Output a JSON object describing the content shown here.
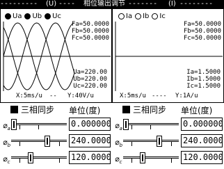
{
  "title": {
    "left_tag": "(U)",
    "center": "相位输出调节",
    "right_tag": "(I)"
  },
  "voltage_panel": {
    "channels": [
      {
        "label": "Ua",
        "selected": true
      },
      {
        "label": "Ub",
        "selected": true
      },
      {
        "label": "Uc",
        "selected": true
      }
    ],
    "freq": [
      "Fa=50.0000",
      "Fb=50.0000",
      "Fc=50.0000"
    ],
    "amps": [
      "Ua=220.00",
      "Ub=220.00",
      "Uc=220.00"
    ],
    "x_scale": "X:5ms/u",
    "y_scale": "Y:40V/u",
    "phases_deg": [
      0,
      240,
      120
    ]
  },
  "current_panel": {
    "channels": [
      {
        "label": "Ia",
        "selected": false
      },
      {
        "label": "Ib",
        "selected": false
      },
      {
        "label": "Ic",
        "selected": false
      }
    ],
    "freq": [
      "Fa=50.0000",
      "Fb=50.0000",
      "Fc=50.0000"
    ],
    "amps": [
      "Ia=1.5000",
      "Ib=1.5000",
      "Ic=1.5000"
    ],
    "x_scale": "X:5ms/u",
    "y_scale": "Y:1A/u"
  },
  "voltage_controls": {
    "sync_label": "三相同步",
    "unit_label": "单位(度)",
    "rows": [
      {
        "sub": "a",
        "value": "0.000000",
        "level": 0.0
      },
      {
        "sub": "b",
        "value": "240.0000",
        "level": 0.667
      },
      {
        "sub": "c",
        "value": "120.0000",
        "level": 0.333
      }
    ]
  },
  "current_controls": {
    "sync_label": "三相同步",
    "unit_label": "单位(度)",
    "rows": [
      {
        "sub": "a",
        "value": "0.000000",
        "level": 0.0
      },
      {
        "sub": "b",
        "value": "240.0000",
        "level": 0.667
      },
      {
        "sub": "c",
        "value": "120.0000",
        "level": 0.333
      }
    ]
  }
}
